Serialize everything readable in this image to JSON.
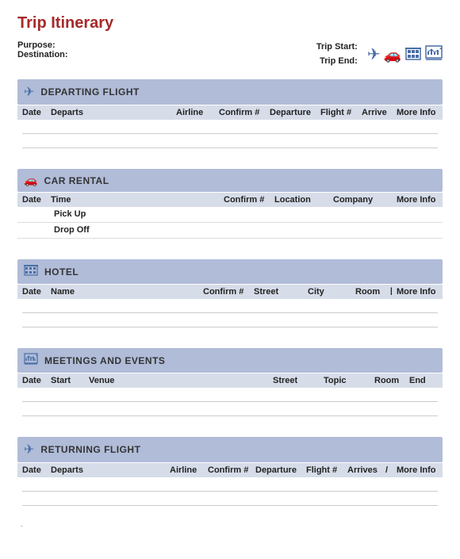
{
  "title": "Trip Itinerary",
  "topLeft": {
    "purposeLabel": "Purpose:",
    "destinationLabel": "Destination:"
  },
  "topRight": {
    "tripStartLabel": "Trip Start:",
    "tripEndLabel": "Trip End:",
    "icons": [
      "✈",
      "🚗",
      "🏨",
      "📊"
    ]
  },
  "sections": {
    "departingFlight": {
      "title": "DEPARTING FLIGHT",
      "icon": "✈",
      "columns": [
        "Date",
        "Departs",
        "Airline",
        "Confirm #",
        "Departure",
        "Flight #",
        "Arrive",
        "More Info"
      ]
    },
    "carRental": {
      "title": "CAR RENTAL",
      "icon": "🚗",
      "columns": [
        "Date",
        "Time",
        "Confirm #",
        "Location",
        "Company",
        "More Info"
      ],
      "subRows": [
        "Pick Up",
        "Drop Off"
      ]
    },
    "hotel": {
      "title": "HOTEL",
      "icon": "🏨",
      "columns": [
        "Date",
        "Name",
        "Confirm #",
        "Street",
        "City",
        "Room",
        "More Info"
      ]
    },
    "meetings": {
      "title": "MEETINGS AND EVENTS",
      "icon": "📊",
      "columns": [
        "Date",
        "Start",
        "Venue",
        "Street",
        "Topic",
        "Room",
        "End"
      ]
    },
    "returningFlight": {
      "title": "RETURNING FLIGHT",
      "icon": "✈",
      "columns": [
        "Date",
        "Departs",
        "Airline",
        "Confirm #",
        "Departure",
        "Flight #",
        "Arrives",
        "/",
        "More Info"
      ]
    }
  },
  "footer": "."
}
